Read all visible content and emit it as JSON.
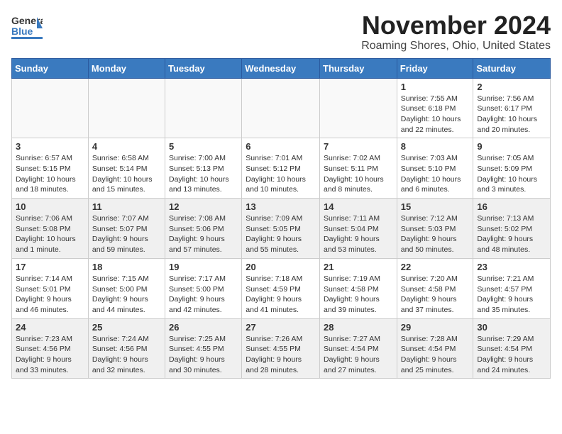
{
  "header": {
    "logo_line1": "General",
    "logo_line2": "Blue",
    "month_title": "November 2024",
    "location": "Roaming Shores, Ohio, United States"
  },
  "weekdays": [
    "Sunday",
    "Monday",
    "Tuesday",
    "Wednesday",
    "Thursday",
    "Friday",
    "Saturday"
  ],
  "weeks": [
    [
      {
        "day": "",
        "info": ""
      },
      {
        "day": "",
        "info": ""
      },
      {
        "day": "",
        "info": ""
      },
      {
        "day": "",
        "info": ""
      },
      {
        "day": "",
        "info": ""
      },
      {
        "day": "1",
        "info": "Sunrise: 7:55 AM\nSunset: 6:18 PM\nDaylight: 10 hours\nand 22 minutes."
      },
      {
        "day": "2",
        "info": "Sunrise: 7:56 AM\nSunset: 6:17 PM\nDaylight: 10 hours\nand 20 minutes."
      }
    ],
    [
      {
        "day": "3",
        "info": "Sunrise: 6:57 AM\nSunset: 5:15 PM\nDaylight: 10 hours\nand 18 minutes."
      },
      {
        "day": "4",
        "info": "Sunrise: 6:58 AM\nSunset: 5:14 PM\nDaylight: 10 hours\nand 15 minutes."
      },
      {
        "day": "5",
        "info": "Sunrise: 7:00 AM\nSunset: 5:13 PM\nDaylight: 10 hours\nand 13 minutes."
      },
      {
        "day": "6",
        "info": "Sunrise: 7:01 AM\nSunset: 5:12 PM\nDaylight: 10 hours\nand 10 minutes."
      },
      {
        "day": "7",
        "info": "Sunrise: 7:02 AM\nSunset: 5:11 PM\nDaylight: 10 hours\nand 8 minutes."
      },
      {
        "day": "8",
        "info": "Sunrise: 7:03 AM\nSunset: 5:10 PM\nDaylight: 10 hours\nand 6 minutes."
      },
      {
        "day": "9",
        "info": "Sunrise: 7:05 AM\nSunset: 5:09 PM\nDaylight: 10 hours\nand 3 minutes."
      }
    ],
    [
      {
        "day": "10",
        "info": "Sunrise: 7:06 AM\nSunset: 5:08 PM\nDaylight: 10 hours\nand 1 minute."
      },
      {
        "day": "11",
        "info": "Sunrise: 7:07 AM\nSunset: 5:07 PM\nDaylight: 9 hours\nand 59 minutes."
      },
      {
        "day": "12",
        "info": "Sunrise: 7:08 AM\nSunset: 5:06 PM\nDaylight: 9 hours\nand 57 minutes."
      },
      {
        "day": "13",
        "info": "Sunrise: 7:09 AM\nSunset: 5:05 PM\nDaylight: 9 hours\nand 55 minutes."
      },
      {
        "day": "14",
        "info": "Sunrise: 7:11 AM\nSunset: 5:04 PM\nDaylight: 9 hours\nand 53 minutes."
      },
      {
        "day": "15",
        "info": "Sunrise: 7:12 AM\nSunset: 5:03 PM\nDaylight: 9 hours\nand 50 minutes."
      },
      {
        "day": "16",
        "info": "Sunrise: 7:13 AM\nSunset: 5:02 PM\nDaylight: 9 hours\nand 48 minutes."
      }
    ],
    [
      {
        "day": "17",
        "info": "Sunrise: 7:14 AM\nSunset: 5:01 PM\nDaylight: 9 hours\nand 46 minutes."
      },
      {
        "day": "18",
        "info": "Sunrise: 7:15 AM\nSunset: 5:00 PM\nDaylight: 9 hours\nand 44 minutes."
      },
      {
        "day": "19",
        "info": "Sunrise: 7:17 AM\nSunset: 5:00 PM\nDaylight: 9 hours\nand 42 minutes."
      },
      {
        "day": "20",
        "info": "Sunrise: 7:18 AM\nSunset: 4:59 PM\nDaylight: 9 hours\nand 41 minutes."
      },
      {
        "day": "21",
        "info": "Sunrise: 7:19 AM\nSunset: 4:58 PM\nDaylight: 9 hours\nand 39 minutes."
      },
      {
        "day": "22",
        "info": "Sunrise: 7:20 AM\nSunset: 4:58 PM\nDaylight: 9 hours\nand 37 minutes."
      },
      {
        "day": "23",
        "info": "Sunrise: 7:21 AM\nSunset: 4:57 PM\nDaylight: 9 hours\nand 35 minutes."
      }
    ],
    [
      {
        "day": "24",
        "info": "Sunrise: 7:23 AM\nSunset: 4:56 PM\nDaylight: 9 hours\nand 33 minutes."
      },
      {
        "day": "25",
        "info": "Sunrise: 7:24 AM\nSunset: 4:56 PM\nDaylight: 9 hours\nand 32 minutes."
      },
      {
        "day": "26",
        "info": "Sunrise: 7:25 AM\nSunset: 4:55 PM\nDaylight: 9 hours\nand 30 minutes."
      },
      {
        "day": "27",
        "info": "Sunrise: 7:26 AM\nSunset: 4:55 PM\nDaylight: 9 hours\nand 28 minutes."
      },
      {
        "day": "28",
        "info": "Sunrise: 7:27 AM\nSunset: 4:54 PM\nDaylight: 9 hours\nand 27 minutes."
      },
      {
        "day": "29",
        "info": "Sunrise: 7:28 AM\nSunset: 4:54 PM\nDaylight: 9 hours\nand 25 minutes."
      },
      {
        "day": "30",
        "info": "Sunrise: 7:29 AM\nSunset: 4:54 PM\nDaylight: 9 hours\nand 24 minutes."
      }
    ]
  ]
}
